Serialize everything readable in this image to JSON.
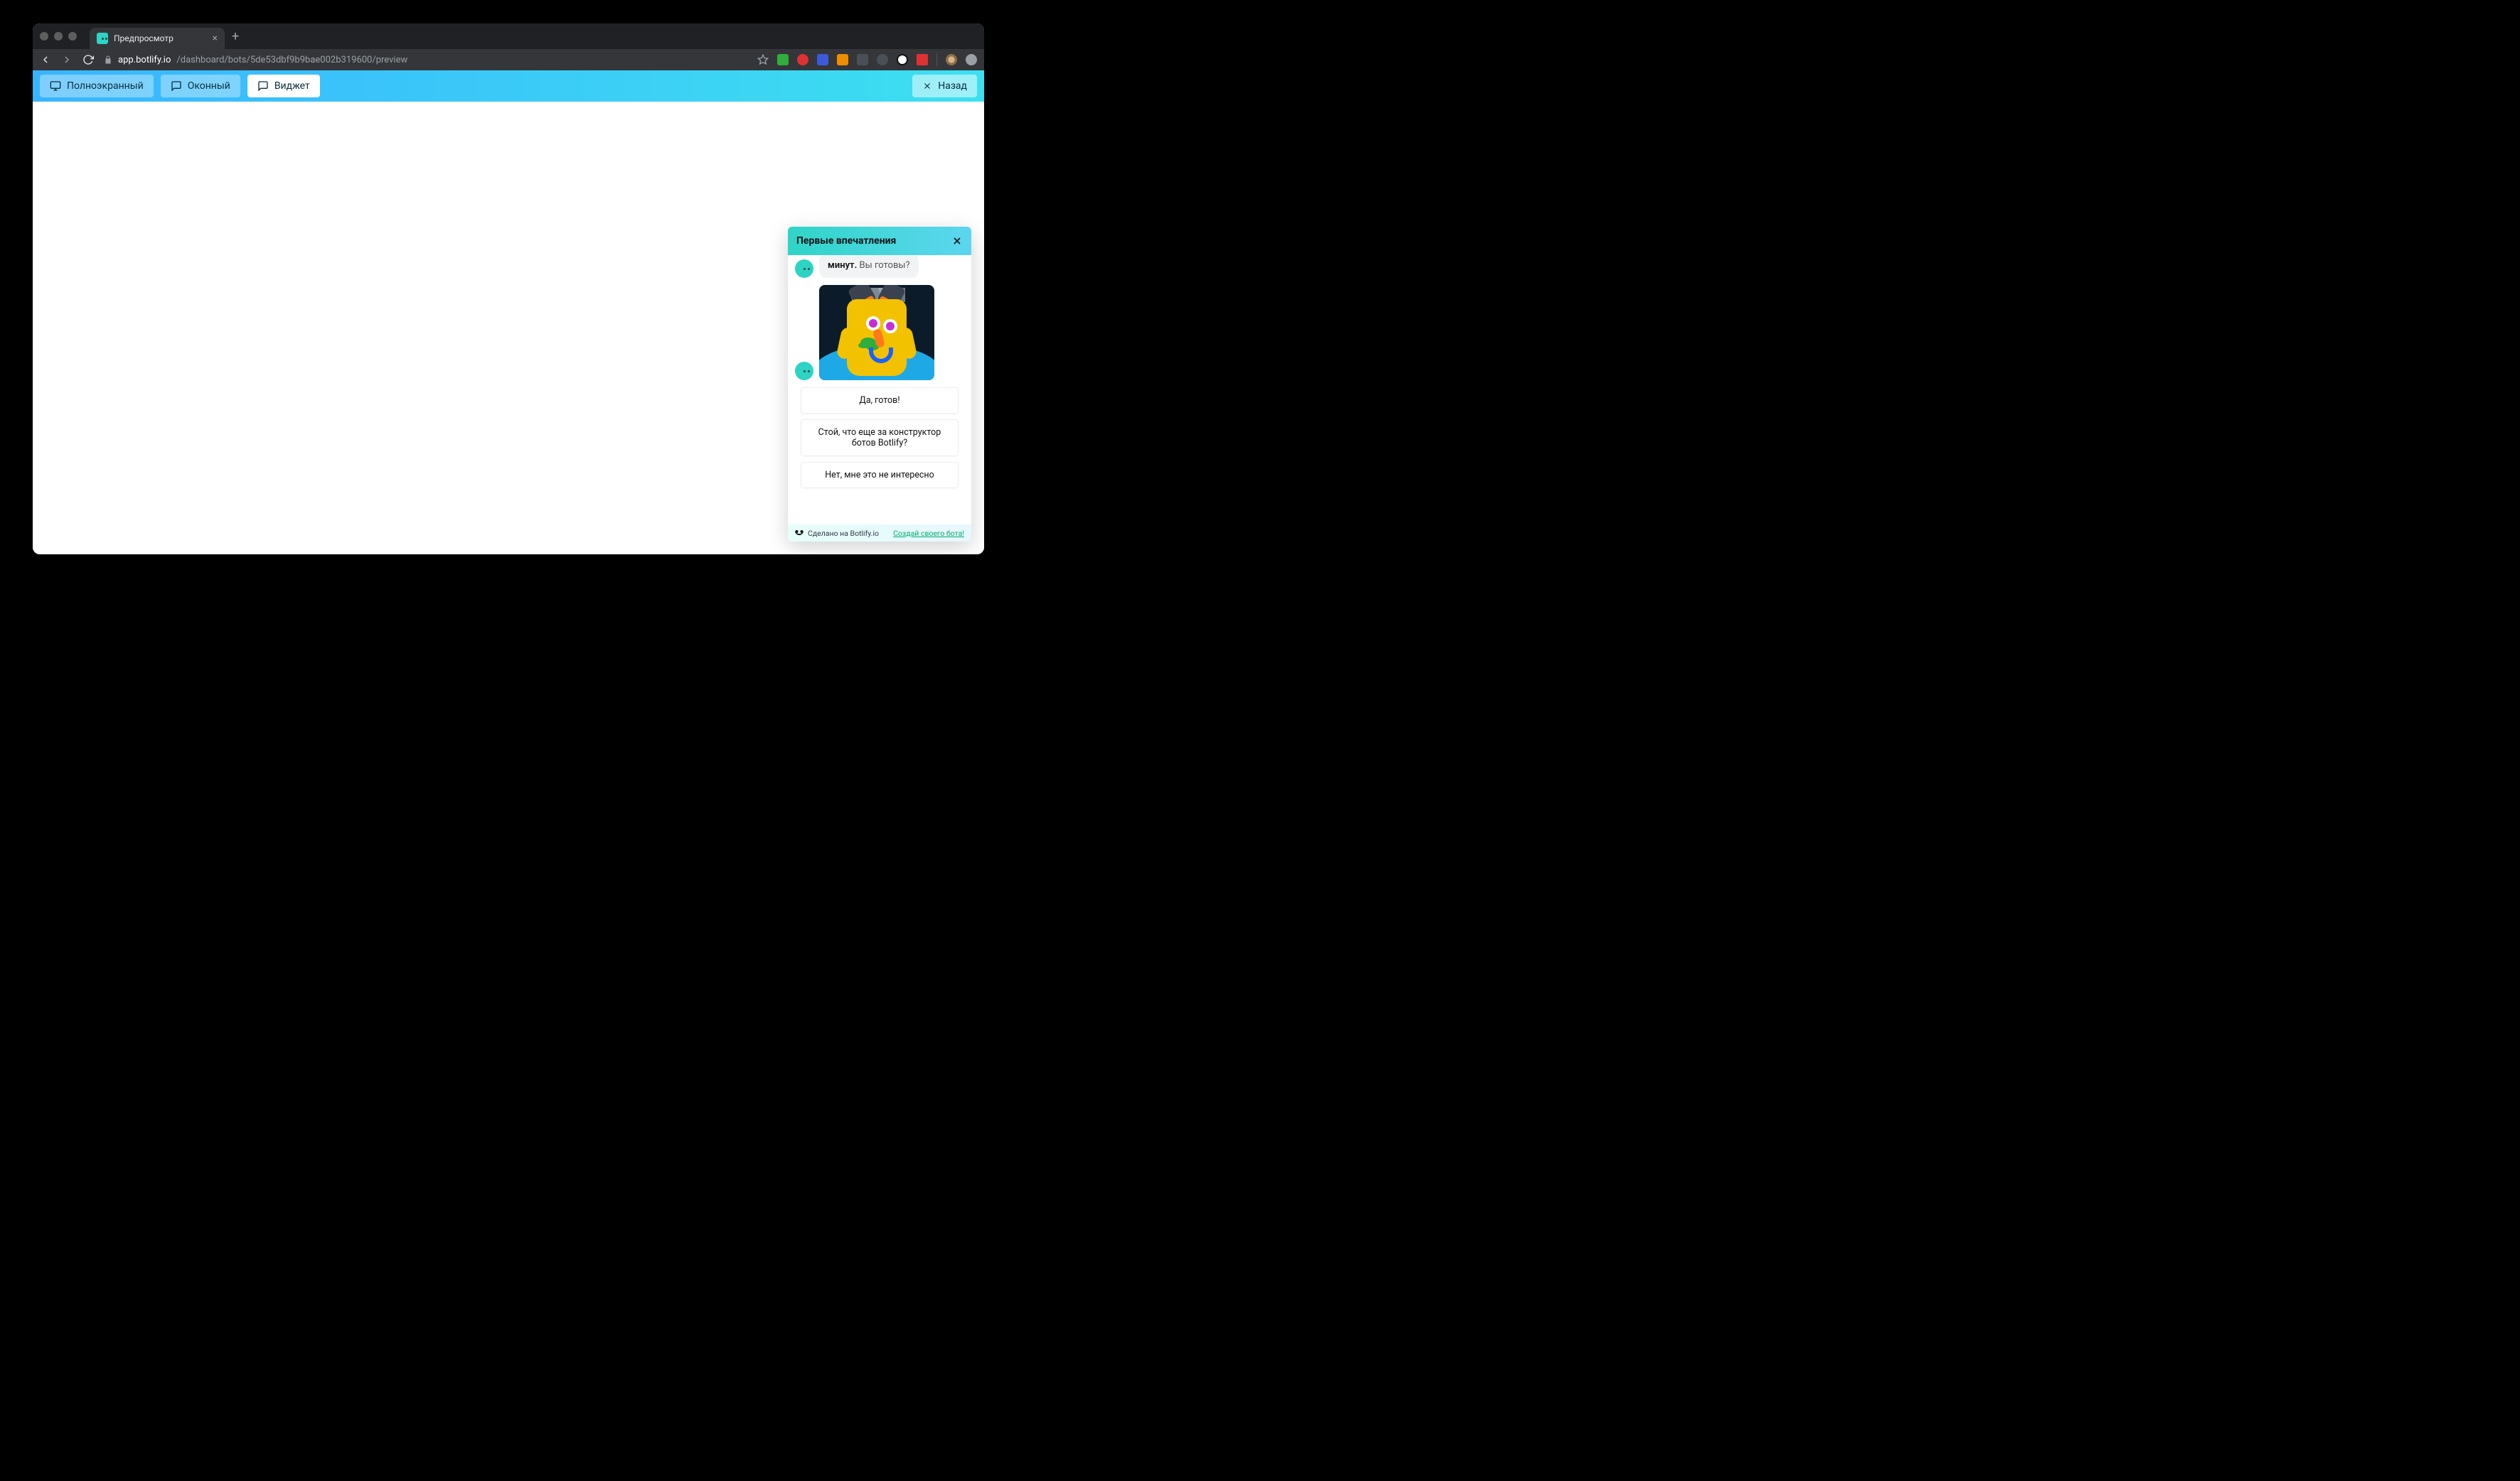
{
  "browser": {
    "tab_title": "Предпросмотр",
    "url_host": "app.botlify.io",
    "url_path": "/dashboard/bots/5de53dbf9b9bae002b319600/preview"
  },
  "toolbar": {
    "modes": [
      {
        "label": "Полноэкранный",
        "active": false
      },
      {
        "label": "Оконный",
        "active": false
      },
      {
        "label": "Виджет",
        "active": true
      }
    ],
    "back_label": "Назад"
  },
  "chat": {
    "title": "Первые впечатления",
    "message_bold": "минут.",
    "message_rest": " Вы готовы?",
    "options": [
      "Да, готов!",
      "Стой, что еще за конструктор ботов Botlify?",
      "Нет, мне это не интересно"
    ],
    "footer_made": "Сделано на Botlify.io",
    "footer_link": "Создай своего бота!"
  }
}
